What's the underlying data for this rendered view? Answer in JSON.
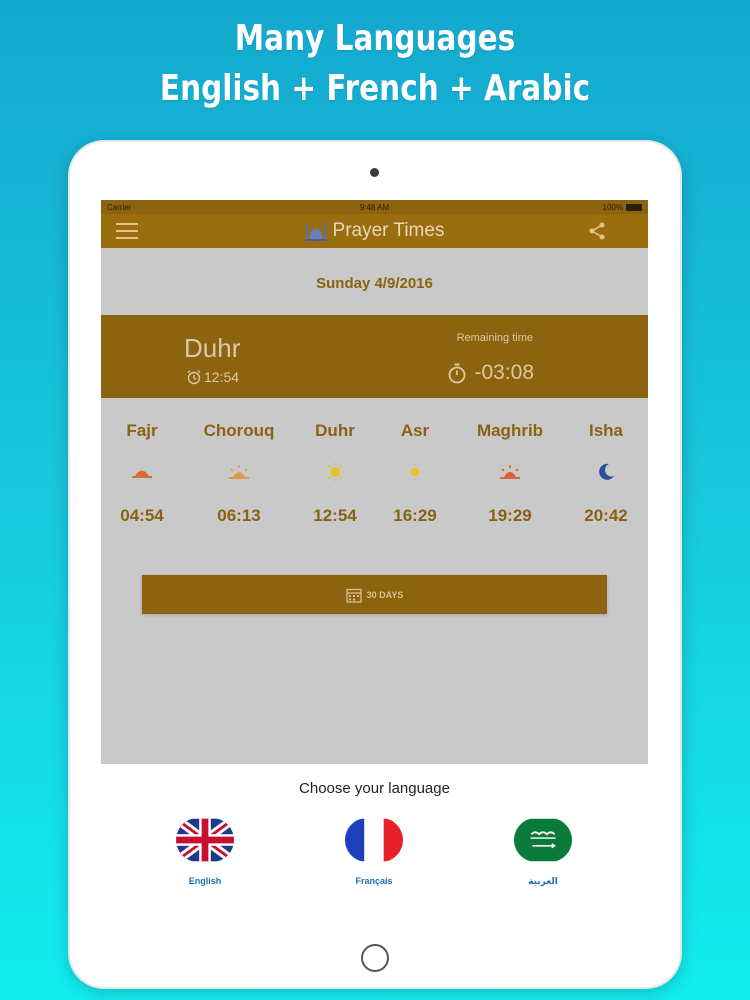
{
  "promo": {
    "line1": "Many Languages",
    "line2": "English + French + Arabic"
  },
  "status_bar": {
    "carrier": "Carrier",
    "time": "9:48 AM",
    "battery": "100%"
  },
  "nav": {
    "title": "Prayer Times"
  },
  "date": "Sunday 4/9/2016",
  "current": {
    "name": "Duhr",
    "time": "12:54",
    "remaining_label": "Remaining time",
    "remaining_value": "-03:08"
  },
  "prayers": [
    {
      "name": "Fajr",
      "time": "04:54",
      "icon": "sunrise-icon"
    },
    {
      "name": "Chorouq",
      "time": "06:13",
      "icon": "sun-rising-icon"
    },
    {
      "name": "Duhr",
      "time": "12:54",
      "icon": "sun-icon"
    },
    {
      "name": "Asr",
      "time": "16:29",
      "icon": "sun-icon"
    },
    {
      "name": "Maghrib",
      "time": "19:29",
      "icon": "sunset-icon"
    },
    {
      "name": "Isha",
      "time": "20:42",
      "icon": "moon-icon"
    }
  ],
  "days_button": "30 DAYS",
  "language_sheet": {
    "title": "Choose your language",
    "options": [
      {
        "label": "English",
        "icon": "uk-flag-icon"
      },
      {
        "label": "Français",
        "icon": "france-flag-icon"
      },
      {
        "label": "العربية",
        "icon": "saudi-flag-icon"
      }
    ]
  },
  "colors": {
    "accent": "#9a6d0f",
    "accent_text": "#8a6210",
    "link": "#1a6fb5"
  }
}
